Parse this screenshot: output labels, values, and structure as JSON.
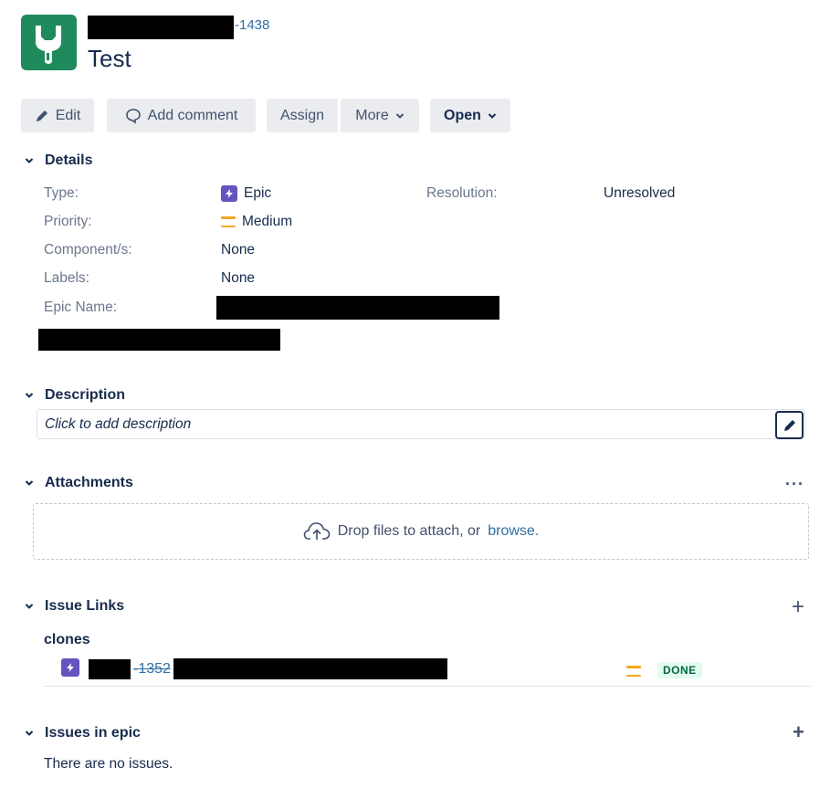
{
  "issue": {
    "key_suffix": "-1438",
    "title": "Test"
  },
  "toolbar": {
    "edit_label": "Edit",
    "add_comment_label": "Add comment",
    "assign_label": "Assign",
    "more_label": "More",
    "status_label": "Open"
  },
  "details": {
    "heading": "Details",
    "type_label": "Type:",
    "type_value": "Epic",
    "priority_label": "Priority:",
    "priority_value": "Medium",
    "components_label": "Component/s:",
    "components_value": "None",
    "labels_label": "Labels:",
    "labels_value": "None",
    "epic_name_label": "Epic Name:",
    "resolution_label": "Resolution:",
    "resolution_value": "Unresolved"
  },
  "description": {
    "heading": "Description",
    "placeholder": "Click to add description"
  },
  "attachments": {
    "heading": "Attachments",
    "more": "···",
    "drop_text": "Drop files to attach, or",
    "browse_text": "browse."
  },
  "issue_links": {
    "heading": "Issue Links",
    "add": "+",
    "relation": "clones",
    "linked_key_suffix": "-1352",
    "linked_status": "DONE"
  },
  "issues_in_epic": {
    "heading": "Issues in epic",
    "add": "+",
    "empty_text": "There are no issues."
  },
  "colors": {
    "project_avatar": "#1f8a5b",
    "epic": "#6554c0",
    "priority_medium": "#f5a623",
    "link": "#2f6ea5",
    "done_bg": "#e3fcef",
    "done_text": "#006644"
  }
}
